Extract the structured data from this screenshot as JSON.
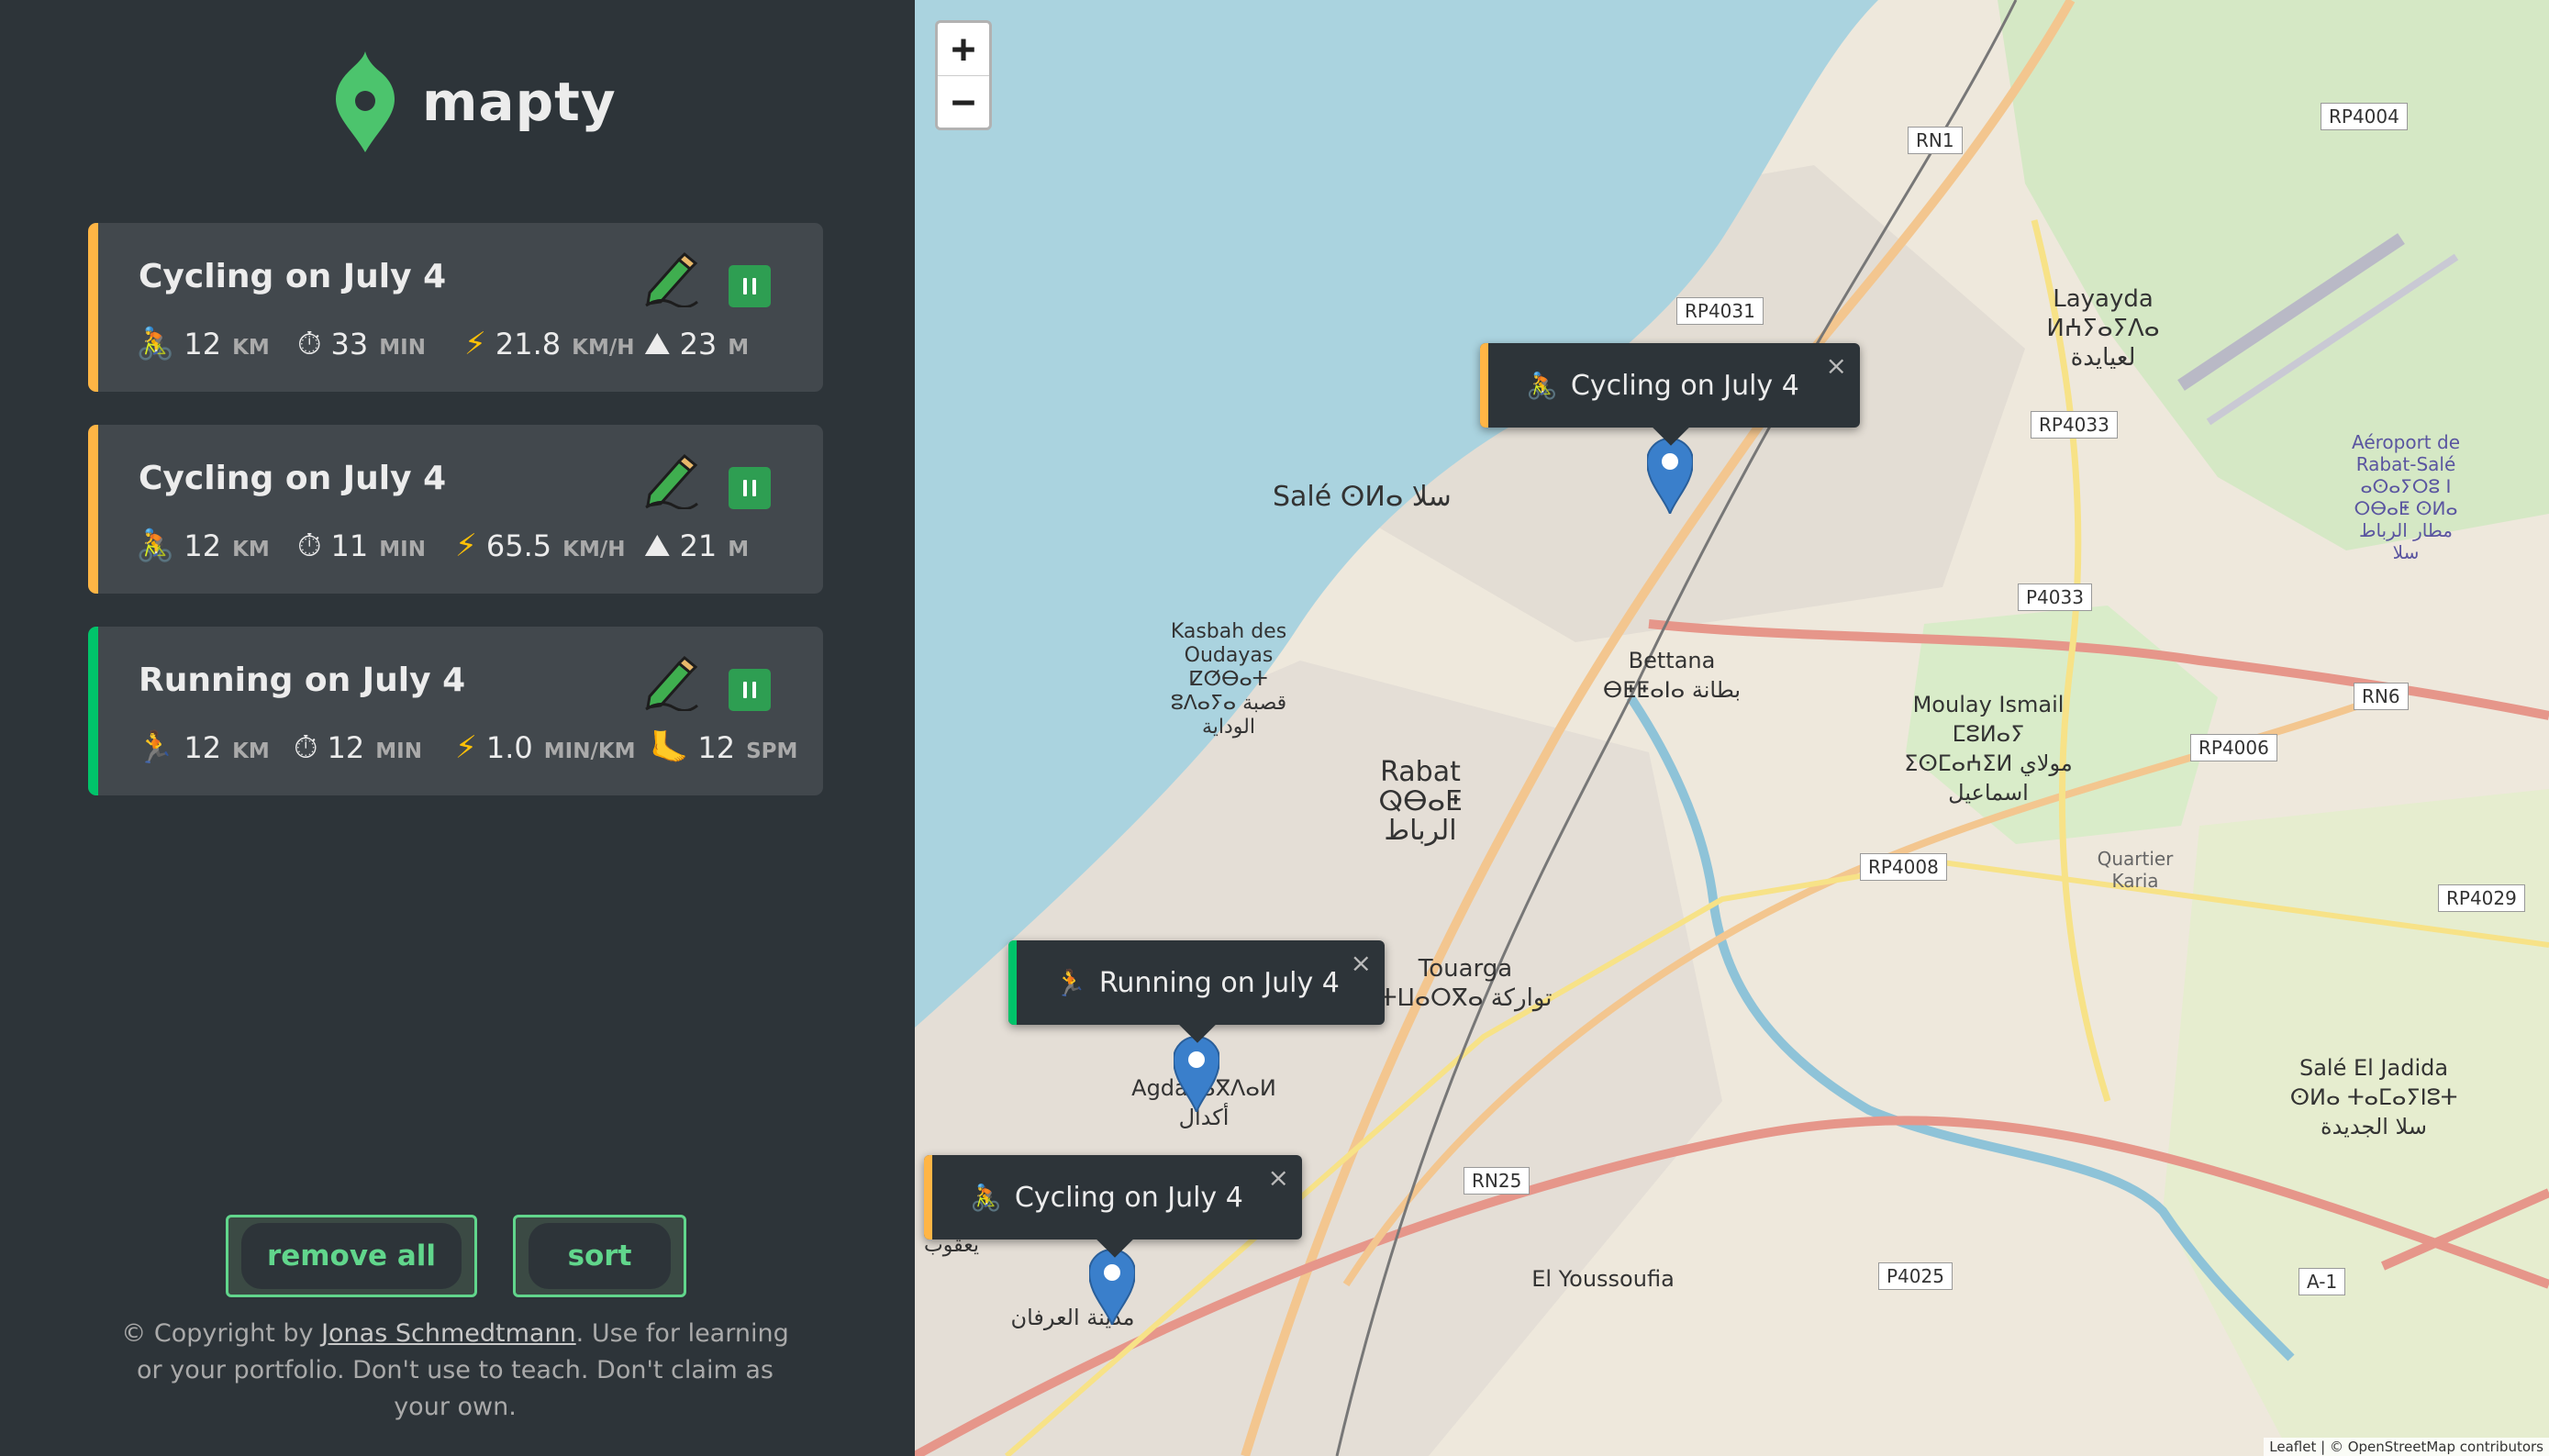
{
  "app": {
    "name": "mapty"
  },
  "colors": {
    "cycling": "#ffb545",
    "running": "#00c46a",
    "accent": "#61d68c",
    "sidebar": "#2d3439",
    "card": "#42484d"
  },
  "workouts": [
    {
      "title": "Cycling on July 4",
      "type": "cycling",
      "icon": "🚴",
      "distance": "12",
      "distance_unit": "KM",
      "duration": "33",
      "duration_unit": "MIN",
      "speed": "21.8",
      "speed_unit": "KM/H",
      "elevation": "23",
      "elevation_unit": "M"
    },
    {
      "title": "Cycling on July 4",
      "type": "cycling",
      "icon": "🚴",
      "distance": "12",
      "distance_unit": "KM",
      "duration": "11",
      "duration_unit": "MIN",
      "speed": "65.5",
      "speed_unit": "KM/H",
      "elevation": "21",
      "elevation_unit": "M"
    },
    {
      "title": "Running on July 4",
      "type": "running",
      "icon": "🏃",
      "distance": "12",
      "distance_unit": "KM",
      "duration": "12",
      "duration_unit": "MIN",
      "pace": "1.0",
      "pace_unit": "MIN/KM",
      "cadence": "12",
      "cadence_unit": "SPM"
    }
  ],
  "buttons": {
    "remove_all": "remove all",
    "sort": "sort"
  },
  "copyright": {
    "prefix": "© Copyright by ",
    "author": "Jonas Schmedtmann",
    "suffix": ". Use for learning or your portfolio. Don't use to teach. Don't claim as your own."
  },
  "map": {
    "zoom_in": "+",
    "zoom_out": "−",
    "popups": [
      {
        "label": "Cycling on July 4",
        "icon": "🚴"
      },
      {
        "label": "Running on July 4",
        "icon": "🏃"
      },
      {
        "label": "Cycling on July 4",
        "icon": "🚴"
      }
    ],
    "close_symbol": "×",
    "places": {
      "sale": "Salé ⵙⵍⴰ سلا",
      "layayda": "Layayda ⵍⵄⵢⴰⵢⴷⴰ لعيايدة",
      "airport": "Aéroport de Rabat-Salé ⴰⵙⴰⵢⵔⵓ ⵏ ⵔⴱⴰⵟ ⵙⵍⴰ مطار الرباط سلا",
      "kasbah": "Kasbah des Oudayas ⵇⵚⴱⴰⵜ ⵓⴷⴰⵢⴰ قصبة الوداية",
      "bettana": "Bettana ⴱⵟⵟⴰⵏⴰ بطانة",
      "moulay": "Moulay Ismail ⵎⵓⵍⴰⵢ ⵉⵙⵎⴰⵄⵉⵍ مولاي اسماعيل",
      "rabat": "Rabat ⵕⴱⴰⵟ الرباط",
      "quartier": "Quartier Karia",
      "touarga": "Touarga ⵜⵡⴰⵔⴳⴰ تواركة",
      "agdal": "Agdal ⴰⴳⴷⴰⵍ أكدال",
      "sale_jadida": "Salé El Jadida ⵙⵍⴰ ⵜⴰⵎⴰⵢⵏⵓⵜ سلا الجديدة",
      "youssoufia": "El Youssoufia",
      "irfane": "مدينة العرفان",
      "yacoub": "يعقوب"
    },
    "roads": [
      "RN1",
      "RP4004",
      "RP4031",
      "RP4033",
      "P4033",
      "RN6",
      "RP4006",
      "RP4008",
      "RP4029",
      "RN25",
      "P4025",
      "A-1"
    ],
    "attribution": "Leaflet | © OpenStreetMap contributors"
  }
}
